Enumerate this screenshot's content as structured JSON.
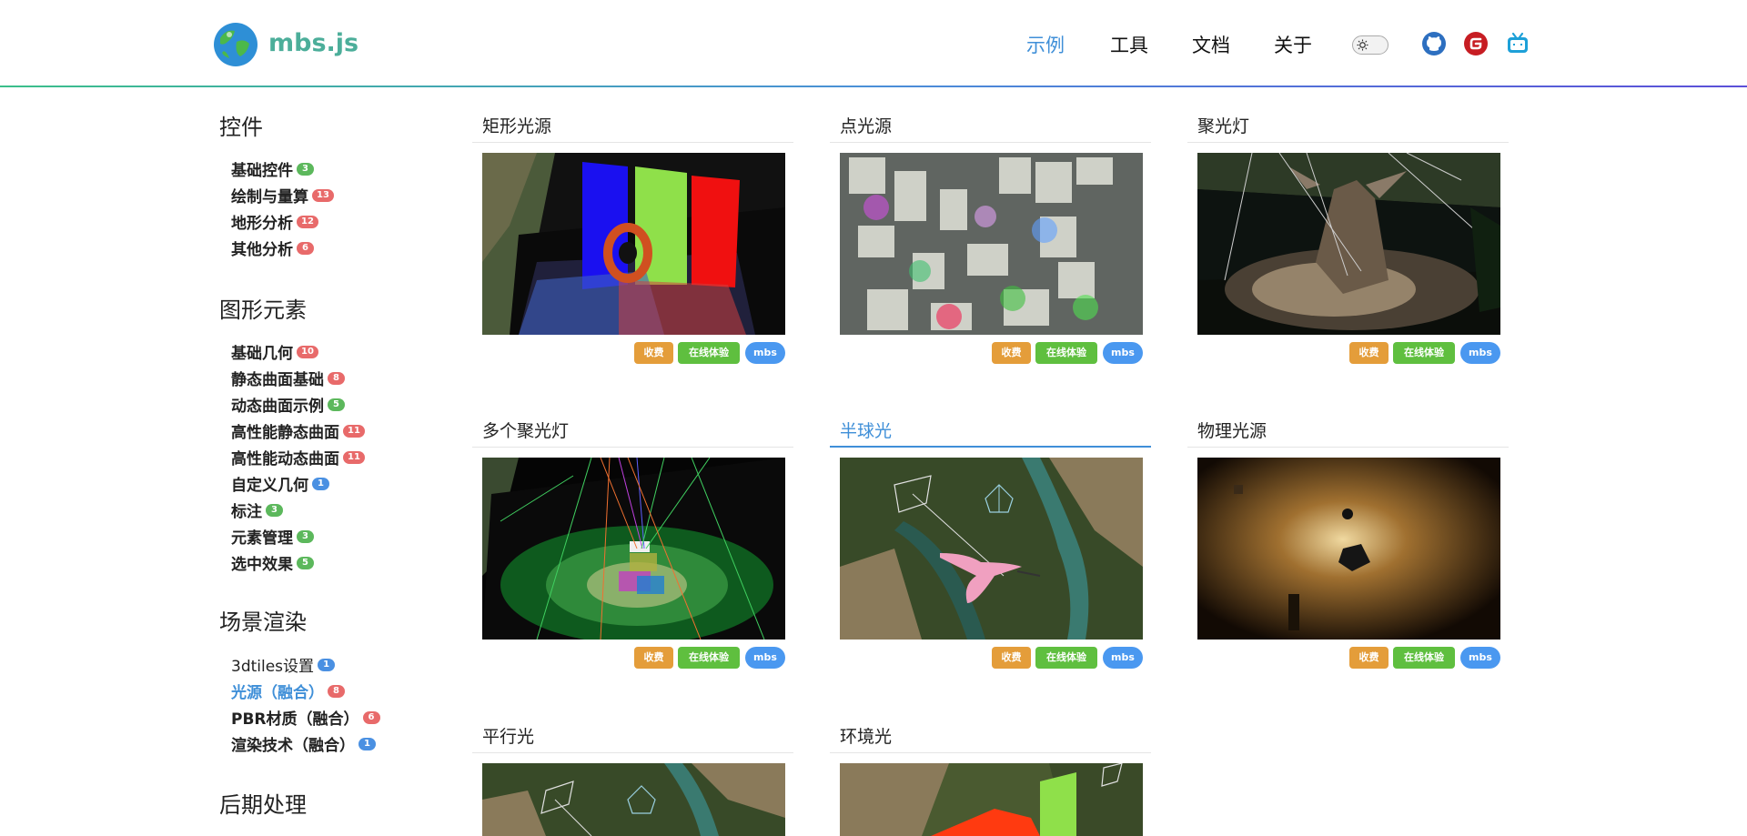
{
  "header": {
    "brand": "mbs.js",
    "nav": [
      "示例",
      "工具",
      "文档",
      "关于"
    ],
    "active_nav": "示例",
    "icons": [
      "github-icon",
      "gitee-icon",
      "bilibili-icon"
    ]
  },
  "sidebar": {
    "sections": [
      {
        "title": "控件",
        "items": [
          {
            "label": "基础控件",
            "count": "3"
          },
          {
            "label": "绘制与量算",
            "count": "13"
          },
          {
            "label": "地形分析",
            "count": "12"
          },
          {
            "label": "其他分析",
            "count": "6"
          }
        ]
      },
      {
        "title": "图形元素",
        "items": [
          {
            "label": "基础几何",
            "count": "10"
          },
          {
            "label": "静态曲面基础",
            "count": "8"
          },
          {
            "label": "动态曲面示例",
            "count": "5"
          },
          {
            "label": "高性能静态曲面",
            "count": "11"
          },
          {
            "label": "高性能动态曲面",
            "count": "11"
          },
          {
            "label": "自定义几何",
            "count": "1"
          },
          {
            "label": "标注",
            "count": "3"
          },
          {
            "label": "元素管理",
            "count": "3"
          },
          {
            "label": "选中效果",
            "count": "5"
          }
        ]
      },
      {
        "title": "场景渲染",
        "items": [
          {
            "label": "3dtiles设置",
            "count": "1"
          },
          {
            "label": "光源（融合）",
            "count": "8"
          },
          {
            "label": "PBR材质（融合）",
            "count": "6"
          },
          {
            "label": "渲染技术（融合）",
            "count": "1"
          }
        ]
      },
      {
        "title": "后期处理",
        "items": []
      }
    ]
  },
  "cards": [
    {
      "title": "矩形光源"
    },
    {
      "title": "点光源"
    },
    {
      "title": "聚光灯"
    },
    {
      "title": "多个聚光灯"
    },
    {
      "title": "半球光"
    },
    {
      "title": "物理光源"
    },
    {
      "title": "平行光"
    },
    {
      "title": "环境光"
    }
  ],
  "card_buttons": {
    "fav": "收费",
    "try": "在线体验",
    "mbs": "mbs"
  },
  "colors": {
    "accent": "#3f8fd8",
    "brand": "#4cae9a",
    "fav": "#e49d3a",
    "try": "#5fbf3f",
    "mbs": "#4a98f0"
  }
}
